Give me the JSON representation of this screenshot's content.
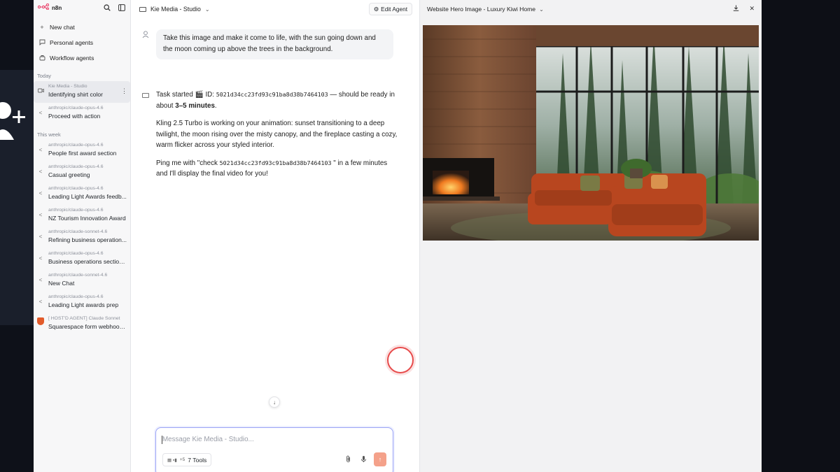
{
  "sidebar": {
    "logo": "n8n",
    "nav": [
      {
        "label": "New chat",
        "icon": "plus-icon"
      },
      {
        "label": "Personal agents",
        "icon": "chat-bubble-icon"
      },
      {
        "label": "Workflow agents",
        "icon": "workflow-icon"
      }
    ],
    "sections": {
      "today": "Today",
      "this_week": "This week"
    },
    "today_items": [
      {
        "sub": "Kie Media - Studio",
        "title": "Identifying shirt color",
        "icon": "video-icon"
      },
      {
        "sub": "anthropic/claude-opus-4.6",
        "title": "Proceed with action",
        "icon": "share-icon"
      }
    ],
    "week_items": [
      {
        "sub": "anthropic/claude-opus-4.6",
        "title": "People first award section",
        "icon": "share-icon"
      },
      {
        "sub": "anthropic/claude-opus-4.6",
        "title": "Casual greeting",
        "icon": "share-icon"
      },
      {
        "sub": "anthropic/claude-opus-4.6",
        "title": "Leading Light Awards feedb...",
        "icon": "share-icon"
      },
      {
        "sub": "anthropic/claude-opus-4.6",
        "title": "NZ Tourism Innovation Award",
        "icon": "share-icon"
      },
      {
        "sub": "anthropic/claude-sonnet-4.6",
        "title": "Refining business operation...",
        "icon": "share-icon"
      },
      {
        "sub": "anthropic/claude-opus-4.6",
        "title": "Business operations section ...",
        "icon": "share-icon"
      },
      {
        "sub": "anthropic/claude-sonnet-4.6",
        "title": "New Chat",
        "icon": "share-icon"
      },
      {
        "sub": "anthropic/claude-opus-4.6",
        "title": "Leading Light awards prep",
        "icon": "share-icon"
      },
      {
        "sub": "[ HOST'D AGENT] Claude Sonnet",
        "title": "Squarespace form webhook...",
        "icon": "shield-icon"
      }
    ]
  },
  "chat": {
    "agent_name": "Kie Media - Studio",
    "edit_agent_label": "Edit Agent",
    "user_message": "Take this image and make it come to life, with the sun going down and the moon coming up above the trees in the background.",
    "bot": {
      "task_prefix": "Task started 🎬 ID:",
      "task_id": "5021d34cc23fd93c91ba8d38b7464103",
      "task_suffix_1": "— should be ready in about",
      "eta": "3–5 minutes",
      "task_suffix_2": ".",
      "paragraph_2": "Kling 2.5 Turbo is working on your animation: sunset transitioning to a deep twilight, the moon rising over the misty canopy, and the fireplace casting a cozy, warm flicker across your styled interior.",
      "ping_prefix": "Ping me with \"check",
      "ping_id": "5021d34cc23fd93c91ba8d38b7464103",
      "ping_suffix": "\" in a few minutes and I'll display the final video for you!"
    },
    "composer": {
      "placeholder": "Message Kie Media - Studio...",
      "tools_mini": "+5",
      "tools_label": "7 Tools"
    }
  },
  "preview": {
    "title": "Website Hero Image - Luxury Kiwi Home"
  },
  "colors": {
    "accent": "#ea4b71",
    "send_button": "#f4a18a",
    "composer_border": "#9aa3f5",
    "record_ring": "#e74a4a"
  }
}
